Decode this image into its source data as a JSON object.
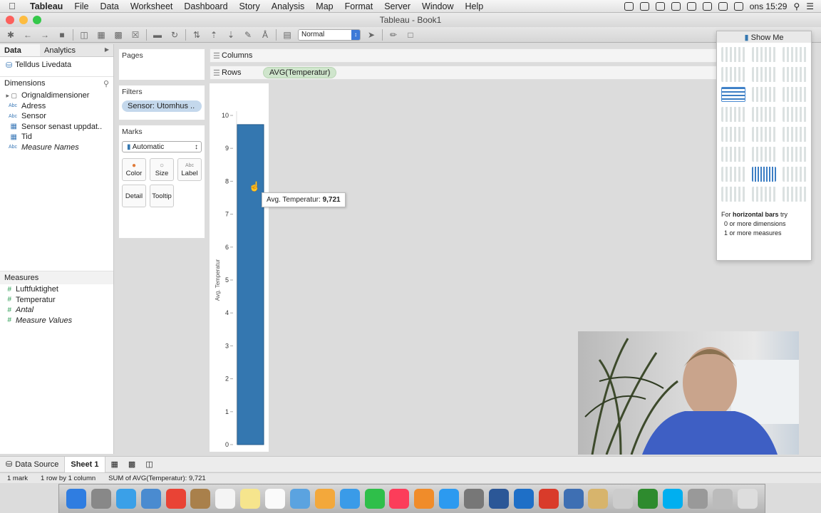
{
  "menubar": {
    "items": [
      "Tableau",
      "File",
      "Data",
      "Worksheet",
      "Dashboard",
      "Story",
      "Analysis",
      "Map",
      "Format",
      "Server",
      "Window",
      "Help"
    ],
    "clock": "ons 15:29"
  },
  "window": {
    "title": "Tableau - Book1"
  },
  "toolbar": {
    "mark_type_select": "Normal"
  },
  "data_pane": {
    "tabs": [
      "Data",
      "Analytics"
    ],
    "datasource": "Telldus Livedata",
    "dimensions_header": "Dimensions",
    "dimensions": [
      {
        "type": "folder",
        "label": "Orignaldimensioner"
      },
      {
        "type": "Abc",
        "label": "Adress"
      },
      {
        "type": "Abc",
        "label": "Sensor"
      },
      {
        "type": "date",
        "label": "Sensor senast uppdat.."
      },
      {
        "type": "date",
        "label": "Tid"
      },
      {
        "type": "Abc",
        "label": "Measure Names"
      }
    ],
    "measures_header": "Measures",
    "measures": [
      {
        "label": "Luftfuktighet",
        "italic": false
      },
      {
        "label": "Temperatur",
        "italic": false
      },
      {
        "label": "Antal",
        "italic": true
      },
      {
        "label": "Measure Values",
        "italic": true
      }
    ]
  },
  "cards": {
    "pages_title": "Pages",
    "filters_title": "Filters",
    "filter_pill": "Sensor: Utomhus ..",
    "marks_title": "Marks",
    "marks_select": "Automatic",
    "buttons": [
      "Color",
      "Size",
      "Label",
      "Detail",
      "Tooltip"
    ]
  },
  "shelves": {
    "columns_label": "Columns",
    "rows_label": "Rows",
    "rows_pill": "AVG(Temperatur)"
  },
  "chart_data": {
    "type": "bar",
    "categories": [
      ""
    ],
    "values": [
      9.721
    ],
    "ylabel": "Avg. Temperatur",
    "ylim": [
      0,
      10
    ],
    "yticks": [
      0,
      1,
      2,
      3,
      4,
      5,
      6,
      7,
      8,
      9,
      10
    ],
    "bar_color": "#3477b0"
  },
  "tooltip": {
    "label": "Avg. Temperatur:",
    "value": "9,721"
  },
  "show_me": {
    "title": "Show Me",
    "hint_prefix": "For",
    "hint_bold": "horizontal bars",
    "hint_suffix": "try",
    "hint_line2": "0 or more dimensions",
    "hint_line3": "1 or more measures"
  },
  "sheet_bar": {
    "datasource_tab": "Data Source",
    "sheet_tab": "Sheet 1"
  },
  "status_bar": {
    "marks": "1 mark",
    "dims": "1 row by 1 column",
    "sum": "SUM of AVG(Temperatur): 9,721"
  }
}
